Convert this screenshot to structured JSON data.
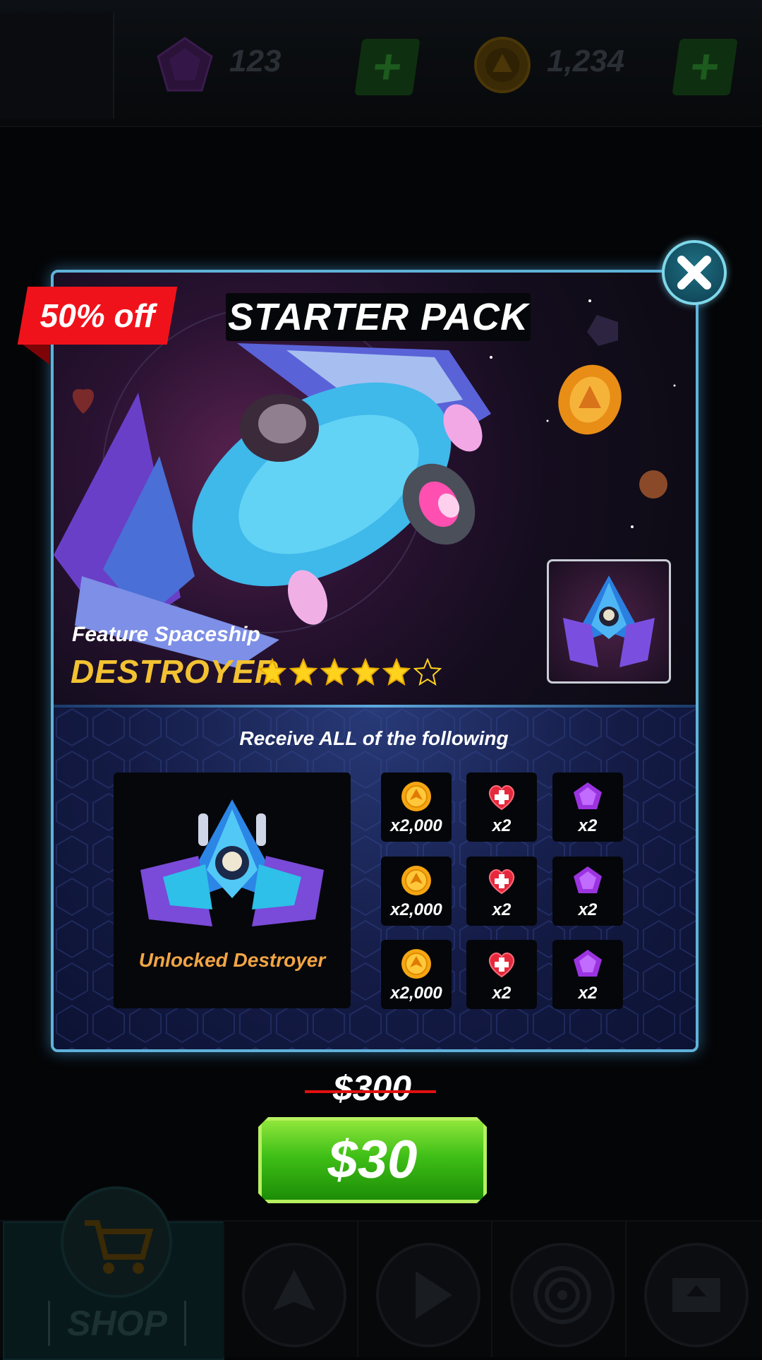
{
  "top_bar": {
    "gems": {
      "value": "123",
      "icon": "gem-icon"
    },
    "coins": {
      "value": "1,234",
      "icon": "coin-icon"
    },
    "add_icon": "plus-icon"
  },
  "bottom_nav": {
    "shop_label": "SHOP",
    "items": [
      "shop-cart-icon",
      "ship-icon",
      "play-icon",
      "target-icon",
      "map-icon"
    ]
  },
  "popup": {
    "title": "STARTER PACK",
    "discount_label": "50% off",
    "feature_label": "Feature Spaceship",
    "ship_name": "DESTROYER",
    "rating": {
      "value": 5,
      "max": 6
    },
    "receive_label": "Receive ALL of the following",
    "unlock_label": "Unlocked Destroyer",
    "rewards": [
      [
        {
          "icon": "coin-icon",
          "qty": "x2,000"
        },
        {
          "icon": "heart-icon",
          "qty": "x2"
        },
        {
          "icon": "gem-icon",
          "qty": "x2"
        }
      ],
      [
        {
          "icon": "coin-icon",
          "qty": "x2,000"
        },
        {
          "icon": "heart-icon",
          "qty": "x2"
        },
        {
          "icon": "gem-icon",
          "qty": "x2"
        }
      ],
      [
        {
          "icon": "coin-icon",
          "qty": "x2,000"
        },
        {
          "icon": "heart-icon",
          "qty": "x2"
        },
        {
          "icon": "gem-icon",
          "qty": "x2"
        }
      ]
    ],
    "old_price": "$300",
    "price": "$30"
  },
  "colors": {
    "accent_border": "#5fb2d9",
    "discount_red": "#f0121b",
    "gold_text": "#f2c232",
    "buy_green": "#3fbf17"
  }
}
